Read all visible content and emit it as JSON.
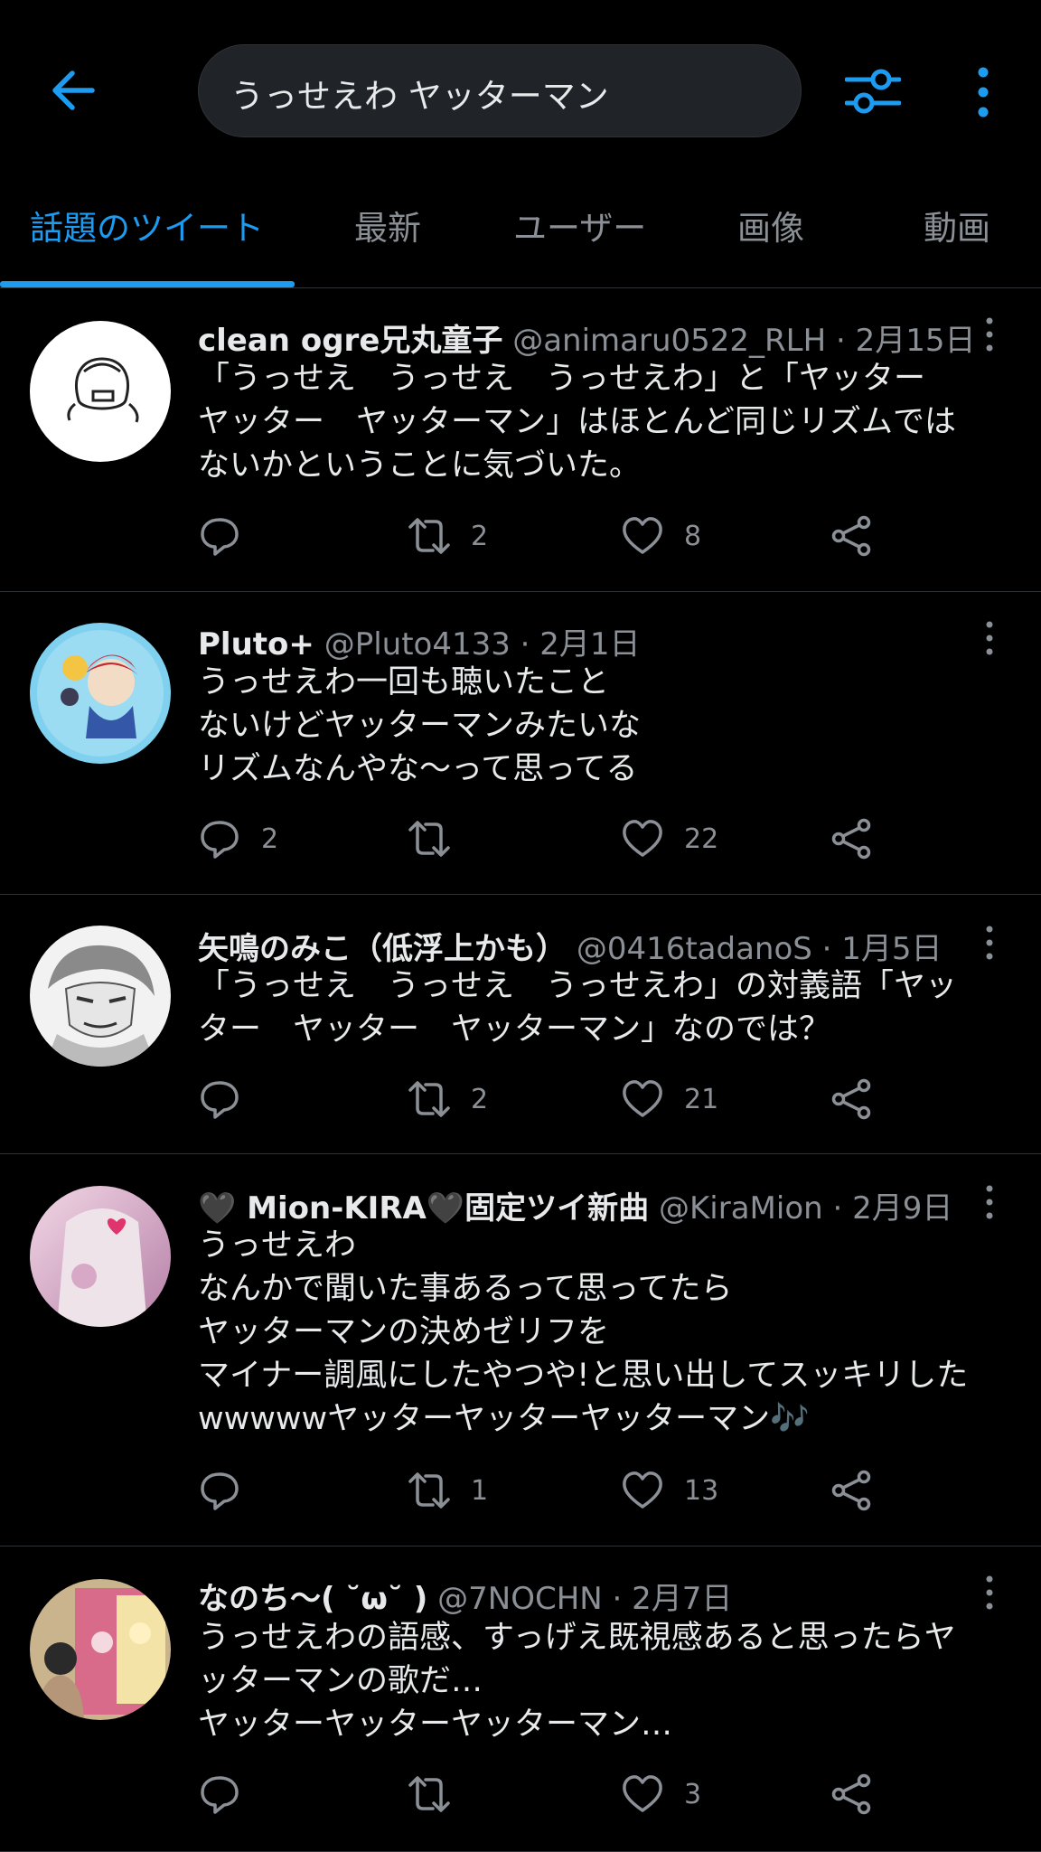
{
  "search": {
    "query": "うっせえわ ヤッターマン"
  },
  "tabs": [
    {
      "label": "話題のツイート",
      "active": true
    },
    {
      "label": "最新"
    },
    {
      "label": "ユーザー"
    },
    {
      "label": "画像"
    },
    {
      "label": "動画"
    }
  ],
  "colors": {
    "accent": "#1d9bf0",
    "background": "#000000",
    "muted": "#8b9096"
  },
  "tweets": [
    {
      "name": "clean ogre兄丸童子",
      "meta": "@animaru0522_RLH · 2月15日",
      "lines": [
        "「うっせえ　うっせえ　うっせえわ」と「ヤッター",
        "ヤッター　ヤッターマン」はほとんど同じリズムでは",
        "ないかということに気づいた。"
      ],
      "replies": "",
      "retweets": "2",
      "likes": "8"
    },
    {
      "name": "Pluto+",
      "meta": "@Pluto4133 · 2月1日",
      "lines": [
        "うっせえわ一回も聴いたこと",
        "ないけどヤッターマンみたいな",
        "リズムなんやな〜って思ってる"
      ],
      "replies": "2",
      "retweets": "",
      "likes": "22"
    },
    {
      "name": "矢鳴のみこ（低浮上かも）",
      "meta": "@0416tadanoS · 1月5日",
      "lines": [
        "「うっせえ　うっせえ　うっせえわ」の対義語「ヤッ",
        "ター　ヤッター　ヤッターマン」なのでは？"
      ],
      "replies": "",
      "retweets": "2",
      "likes": "21"
    },
    {
      "name": "🖤 Mion-KIRA🖤固定ツイ新曲",
      "meta": "@KiraMion · 2月9日",
      "lines": [
        "うっせえわ",
        "なんかで聞いた事あるって思ってたら",
        "ヤッターマンの決めゼリフを",
        "マイナー調風にしたやつや!と思い出してスッキリした",
        "wwwwwヤッターヤッターヤッターマン🎶"
      ],
      "replies": "",
      "retweets": "1",
      "likes": "13"
    },
    {
      "name": "なのち〜( ˘ω˘ )",
      "meta": "@7NOCHN · 2月7日",
      "lines": [
        "うっせえわの語感、すっげえ既視感あると思ったらヤ",
        "ッターマンの歌だ…",
        "ヤッターヤッターヤッターマン…"
      ],
      "replies": "",
      "retweets": "",
      "likes": "3"
    }
  ]
}
